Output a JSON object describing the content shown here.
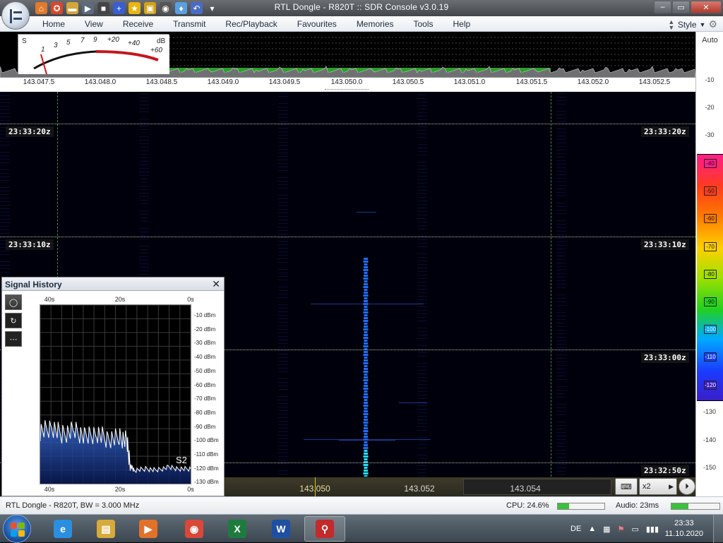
{
  "window": {
    "title": "RTL Dongle - R820T :: SDR Console v3.0.19",
    "controls": {
      "minimize": "–",
      "maximize": "▭",
      "close": "✕"
    }
  },
  "quick_access": [
    {
      "icon": "home-icon",
      "glyph": "⌂",
      "color": "#e07a2c"
    },
    {
      "icon": "lifebuoy-icon",
      "glyph": "✪",
      "color": "#d9472b"
    },
    {
      "icon": "folder-icon",
      "glyph": "▬",
      "color": "#d4a73b"
    },
    {
      "icon": "play-icon",
      "glyph": "▶",
      "color": "#5b6a7d"
    },
    {
      "icon": "stop-icon",
      "glyph": "■",
      "color": "#444"
    },
    {
      "icon": "add-icon",
      "glyph": "+",
      "color": "#3a5ed1"
    },
    {
      "icon": "star-icon",
      "glyph": "★",
      "color": "#e8b512"
    },
    {
      "icon": "lock-icon",
      "glyph": "▣",
      "color": "#d2a21a"
    },
    {
      "icon": "camera-icon",
      "glyph": "◉",
      "color": "#555"
    },
    {
      "icon": "drop-icon",
      "glyph": "♦",
      "color": "#5aa0e0"
    },
    {
      "icon": "undo-icon",
      "glyph": "↶",
      "color": "#4a6cc1"
    },
    {
      "icon": "customize-arrow-icon",
      "glyph": "▾",
      "color": "transparent"
    }
  ],
  "menu": {
    "items": [
      "Home",
      "View",
      "Receive",
      "Transmit",
      "Rec/Playback",
      "Favourites",
      "Memories",
      "Tools",
      "Help"
    ],
    "style_label": "Style"
  },
  "smeter": {
    "unit_left": "S",
    "unit_right": "dB",
    "scale_black": [
      "1",
      "3",
      "5",
      "7",
      "9"
    ],
    "scale_red": [
      "+20",
      "+40",
      "+60"
    ]
  },
  "frequency_axis": {
    "labels": [
      "143.047.5",
      "143.048.0",
      "143.048.5",
      "143.049.0",
      "143.049.5",
      "143.050.0",
      "143.050.5",
      "143.051.0",
      "143.051.5",
      "143.052.0",
      "143.052.5"
    ]
  },
  "waterfall": {
    "time_labels": [
      "23:33:20z",
      "23:33:10z",
      "23:33:00z",
      "23:32:50z"
    ]
  },
  "level_scale": {
    "auto_label": "Auto",
    "labels": [
      "-10",
      "-20",
      "-30",
      "-40",
      "-50",
      "-60",
      "-70",
      "-80",
      "-90",
      "-100",
      "-110",
      "-120",
      "-130",
      "-140",
      "-150"
    ],
    "palette": [
      {
        "label": "-40",
        "color": "#ff1e87"
      },
      {
        "label": "-50",
        "color": "#ff3c1e"
      },
      {
        "label": "-60",
        "color": "#ff7a00"
      },
      {
        "label": "-70",
        "color": "#ffd000"
      },
      {
        "label": "-80",
        "color": "#a0e000"
      },
      {
        "label": "-90",
        "color": "#22d11e"
      },
      {
        "label": "-100",
        "color": "#00aaff"
      },
      {
        "label": "-110",
        "color": "#1a3cff"
      },
      {
        "label": "-120",
        "color": "#3a1ec8"
      }
    ]
  },
  "bottom_strip": {
    "freq_labels": [
      "143.050",
      "143.052",
      "143.054"
    ],
    "keyboard_icon": "⌨",
    "zoom_label": "x2",
    "play_icon": "▶",
    "playback_icon": "⏵"
  },
  "signal_history": {
    "title": "Signal History",
    "close": "✕",
    "tools": [
      "◯",
      "↻",
      "⋯"
    ],
    "x_labels_top": [
      "40s",
      "20s",
      "0s"
    ],
    "x_labels_bottom": [
      "40s",
      "20s",
      "0s"
    ],
    "y_labels": [
      "-10 dBm",
      "-20 dBm",
      "-30 dBm",
      "-40 dBm",
      "-50 dBm",
      "-60 dBm",
      "-70 dBm",
      "-80 dBm",
      "-90 dBm",
      "-100 dBm",
      "-110 dBm",
      "-120 dBm",
      "-130 dBm"
    ],
    "s_unit": "S2"
  },
  "chart_data": {
    "type": "line",
    "x": [
      -40,
      -37,
      -34,
      -31,
      -28,
      -25,
      -22,
      -19,
      -17,
      -16,
      -15,
      -12,
      -9,
      -6,
      -3,
      0
    ],
    "series": [
      {
        "values": [
          -95,
          -92,
          -97,
          -94,
          -99,
          -96,
          -100,
          -99,
          -101,
          -118,
          -121,
          -120,
          -121,
          -119,
          -120,
          -120
        ]
      }
    ],
    "x_labels": [
      "40s",
      "20s",
      "0s"
    ],
    "y_labels": [
      "-10 dBm",
      "-20 dBm",
      "-30 dBm",
      "-40 dBm",
      "-50 dBm",
      "-60 dBm",
      "-70 dBm",
      "-80 dBm",
      "-90 dBm",
      "-100 dBm",
      "-110 dBm",
      "-120 dBm",
      "-130 dBm"
    ],
    "ylim": [
      -130,
      -10
    ],
    "grid": true
  },
  "status": {
    "source": "RTL Dongle - R820T, BW = 3.000 MHz",
    "cpu_label": "CPU: 24.6%",
    "cpu_value": 0.246,
    "audio_label": "Audio: 23ms",
    "audio_value": 0.35
  },
  "taskbar": {
    "apps": [
      {
        "icon": "internet-explorer-icon",
        "glyph": "e",
        "color": "#2b8fe0"
      },
      {
        "icon": "file-explorer-icon",
        "glyph": "▤",
        "color": "#d8a93b"
      },
      {
        "icon": "media-player-icon",
        "glyph": "▶",
        "color": "#e2712a"
      },
      {
        "icon": "chrome-icon",
        "glyph": "◉",
        "color": "#d94838"
      },
      {
        "icon": "excel-icon",
        "glyph": "X",
        "color": "#1e7b3e"
      },
      {
        "icon": "word-icon",
        "glyph": "W",
        "color": "#1f4fa3"
      },
      {
        "icon": "sdr-console-icon",
        "glyph": "⚲",
        "color": "#c22b2b"
      }
    ],
    "language": "DE",
    "time": "23:33",
    "date": "11.10.2020"
  }
}
